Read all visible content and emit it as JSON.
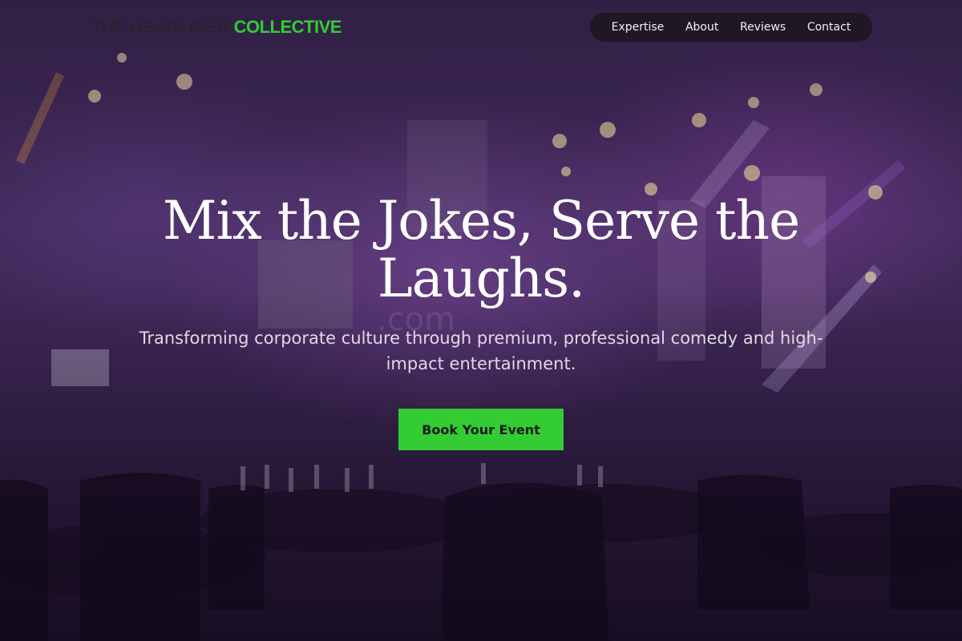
{
  "brand": {
    "name_part1": "THE HEADLINER",
    "name_part2": "COLLECTIVE",
    "accent_color": "#33cc33"
  },
  "nav": {
    "items": [
      {
        "label": "Expertise"
      },
      {
        "label": "About"
      },
      {
        "label": "Reviews"
      },
      {
        "label": "Contact"
      }
    ]
  },
  "hero": {
    "headline": "Mix the Jokes, Serve the Laughs.",
    "subtitle": "Transforming corporate culture through premium, professional comedy and high-impact entertainment.",
    "cta_label": "Book Your Event",
    "background": "event-venue-photo-purple-lighting"
  }
}
